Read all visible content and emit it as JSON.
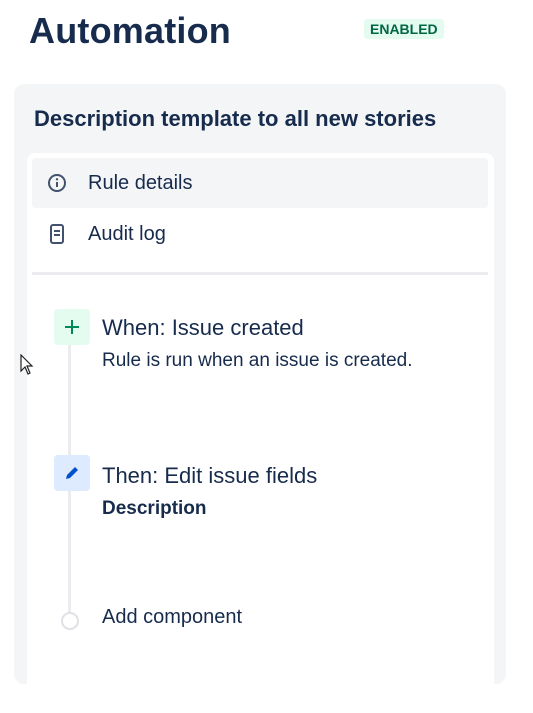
{
  "header": {
    "title": "Automation",
    "status": "ENABLED"
  },
  "rule": {
    "name": "Description template to all new stories",
    "nav": [
      {
        "label": "Rule details",
        "icon": "info-icon",
        "active": true
      },
      {
        "label": "Audit log",
        "icon": "document-icon",
        "active": false
      }
    ],
    "steps": [
      {
        "title": "When: Issue created",
        "subtitle": "Rule is run when an issue is created.",
        "icon": "plus-icon",
        "kind": "trigger"
      },
      {
        "title": "Then: Edit issue fields",
        "subtitle": "Description",
        "icon": "pencil-icon",
        "kind": "action"
      }
    ],
    "add_component_label": "Add component"
  },
  "colors": {
    "title": "#172b4d",
    "badge_bg": "#e3fcef",
    "badge_text": "#006644",
    "panel_bg": "#f4f5f7",
    "trigger_bg": "#e3fcef",
    "trigger_icon": "#00875a",
    "action_bg": "#deebff",
    "action_icon": "#0052cc"
  }
}
